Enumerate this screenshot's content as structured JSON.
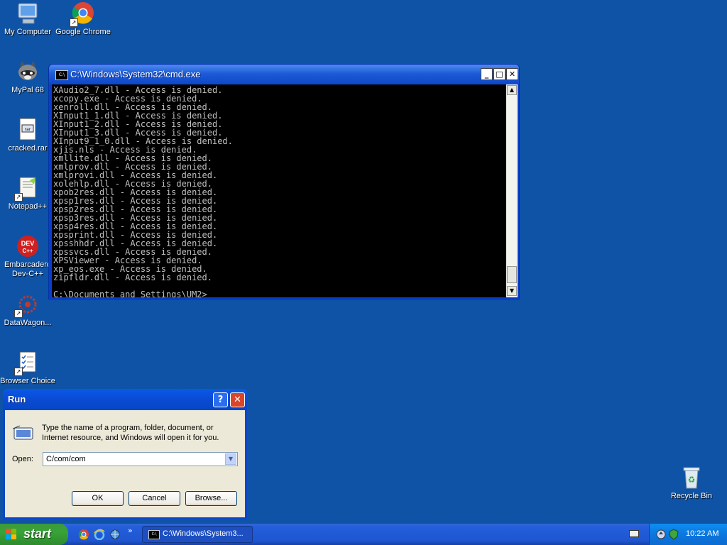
{
  "desktop": {
    "icons": [
      {
        "label": "My Computer"
      },
      {
        "label": "Google Chrome"
      },
      {
        "label": "MyPal 68"
      },
      {
        "label": "cracked.rar"
      },
      {
        "label": "Notepad++"
      },
      {
        "label": "Embarcadero\nDev-C++"
      },
      {
        "label": "DataWagon..."
      },
      {
        "label": "Browser Choice"
      },
      {
        "label": "Recycle Bin"
      }
    ]
  },
  "cmd_window": {
    "title": "C:\\Windows\\System32\\cmd.exe",
    "output": "XAudio2_7.dll - Access is denied.\nxcopy.exe - Access is denied.\nxenroll.dll - Access is denied.\nXInput1_1.dll - Access is denied.\nXInput1_2.dll - Access is denied.\nXInput1_3.dll - Access is denied.\nXInput9_1_0.dll - Access is denied.\nxjis.nls - Access is denied.\nxmllite.dll - Access is denied.\nxmlprov.dll - Access is denied.\nxmlprovi.dll - Access is denied.\nxolehlp.dll - Access is denied.\nxpob2res.dll - Access is denied.\nxpsp1res.dll - Access is denied.\nxpsp2res.dll - Access is denied.\nxpsp3res.dll - Access is denied.\nxpsp4res.dll - Access is denied.\nxpsprint.dll - Access is denied.\nxpsshhdr.dll - Access is denied.\nxpssvcs.dll - Access is denied.\nXPSViewer - Access is denied.\nxp_eos.exe - Access is denied.\nzipfldr.dll - Access is denied.\n\nC:\\Documents and Settings\\UM2>",
    "minimize_glyph": "_",
    "maximize_glyph": "□",
    "close_glyph": "✕",
    "icon_text": "C:\\"
  },
  "run_dialog": {
    "title": "Run",
    "help_glyph": "?",
    "close_glyph": "✕",
    "description": "Type the name of a program, folder, document, or Internet resource, and Windows will open it for you.",
    "open_label": "Open:",
    "open_value": "C/com/com",
    "buttons": {
      "ok": "OK",
      "cancel": "Cancel",
      "browse": "Browse..."
    }
  },
  "taskbar": {
    "start_label": "start",
    "task_label": "C:\\Windows\\System3...",
    "clock": "10:22 AM",
    "quicklaunch_more": "»"
  },
  "colors": {
    "desktop": "#0f53a6",
    "xp_blue": "#0a46c9",
    "start_green": "#37a337"
  }
}
